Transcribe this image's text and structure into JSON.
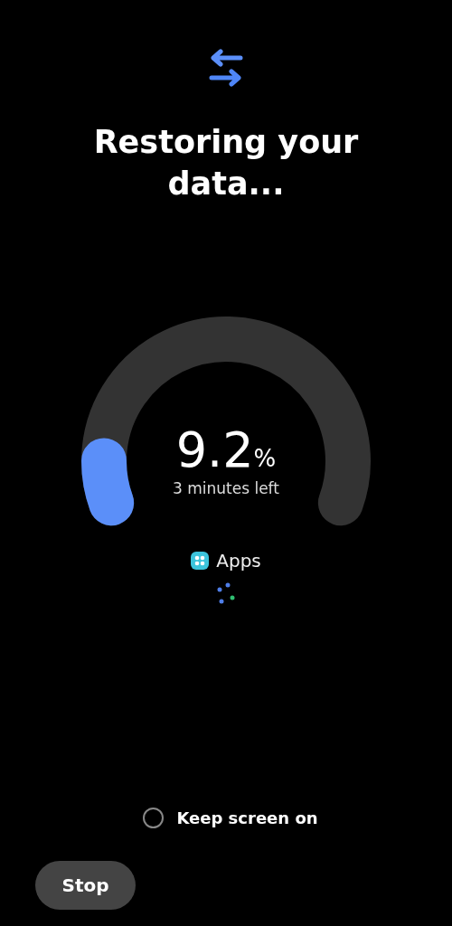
{
  "title": "Restoring your data...",
  "progress": {
    "value": "9.2",
    "unit": "%",
    "time_left": "3 minutes left"
  },
  "current_item": {
    "label": "Apps"
  },
  "keep_screen_on": {
    "label": "Keep screen on",
    "checked": false
  },
  "buttons": [
    {
      "label": "Stop"
    }
  ]
}
